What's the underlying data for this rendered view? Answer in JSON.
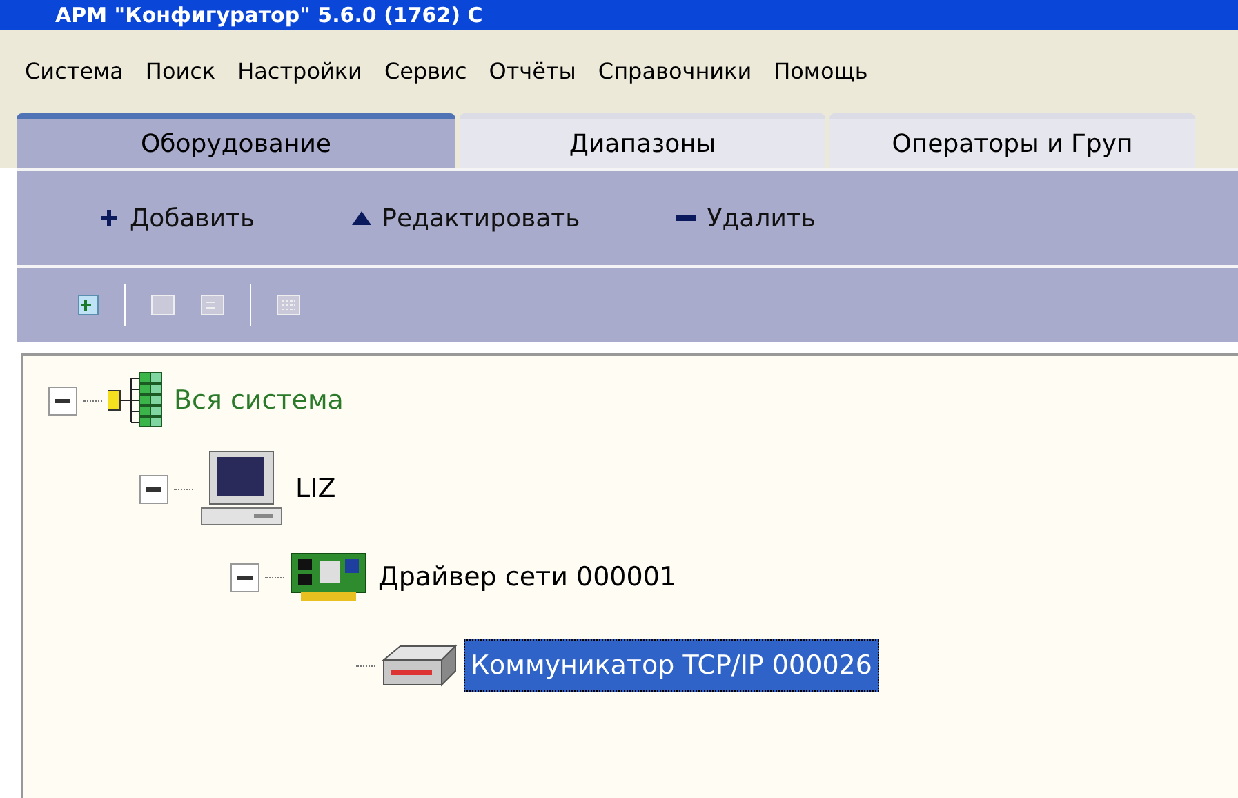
{
  "window": {
    "title": "АРМ \"Конфигуратор\" 5.6.0 (1762) С"
  },
  "menu": [
    "Система",
    "Поиск",
    "Настройки",
    "Сервис",
    "Отчёты",
    "Справочники",
    "Помощь"
  ],
  "tabs": [
    {
      "label": "Оборудование",
      "selected": true
    },
    {
      "label": "Диапазоны",
      "selected": false
    },
    {
      "label": "Операторы и Груп",
      "selected": false
    }
  ],
  "actions": [
    {
      "label": "Добавить",
      "kind": "add"
    },
    {
      "label": "Редактировать",
      "kind": "edit"
    },
    {
      "label": "Удалить",
      "kind": "delete"
    }
  ],
  "tree": [
    {
      "label": "Вся система",
      "kind": "system",
      "expanded": true,
      "selected": false,
      "children": [
        {
          "label": "LIZ",
          "kind": "computer",
          "expanded": true,
          "selected": false,
          "children": [
            {
              "label": "Драйвер сети 000001",
              "kind": "board",
              "expanded": true,
              "selected": false,
              "children": [
                {
                  "label": "Коммуникатор TCP/IP 000026",
                  "kind": "device",
                  "selected": true
                }
              ]
            }
          ]
        }
      ]
    }
  ]
}
